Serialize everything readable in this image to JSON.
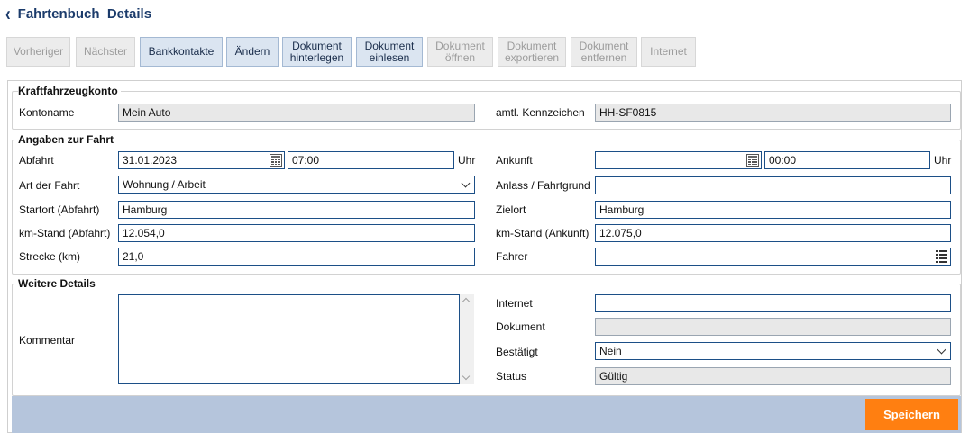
{
  "header": {
    "title": "Fahrtenbuch  Details"
  },
  "toolbar": {
    "vorheriger": "Vorheriger",
    "naechster": "Nächster",
    "bankkontakte": "Bankkontakte",
    "aendern": "Ändern",
    "dok_hinterlegen_1": "Dokument",
    "dok_hinterlegen_2": "hinterlegen",
    "dok_einlesen_1": "Dokument",
    "dok_einlesen_2": "einlesen",
    "dok_oeffnen_1": "Dokument",
    "dok_oeffnen_2": "öffnen",
    "dok_exportieren_1": "Dokument",
    "dok_exportieren_2": "exportieren",
    "dok_entfernen_1": "Dokument",
    "dok_entfernen_2": "entfernen",
    "internet": "Internet"
  },
  "konto": {
    "legend": "Kraftfahrzeugkonto",
    "kontoname_label": "Kontoname",
    "kontoname": "Mein Auto",
    "kennzeichen_label": "amtl. Kennzeichen",
    "kennzeichen": "HH-SF0815"
  },
  "fahrt": {
    "legend": "Angaben zur Fahrt",
    "abfahrt_label": "Abfahrt",
    "abfahrt_datum": "31.01.2023",
    "abfahrt_zeit": "07:00",
    "uhr": "Uhr",
    "ankunft_label": "Ankunft",
    "ankunft_datum": "",
    "ankunft_zeit": "00:00",
    "art_label": "Art der Fahrt",
    "art": "Wohnung / Arbeit",
    "anlass_label": "Anlass / Fahrtgrund",
    "anlass": "",
    "startort_label": "Startort (Abfahrt)",
    "startort": "Hamburg",
    "zielort_label": "Zielort",
    "zielort": "Hamburg",
    "km_abfahrt_label": "km-Stand (Abfahrt)",
    "km_abfahrt": "12.054,0",
    "km_ankunft_label": "km-Stand (Ankunft)",
    "km_ankunft": "12.075,0",
    "strecke_label": "Strecke (km)",
    "strecke": "21,0",
    "fahrer_label": "Fahrer",
    "fahrer": ""
  },
  "details": {
    "legend": "Weitere Details",
    "kommentar_label": "Kommentar",
    "kommentar": "",
    "internet_label": "Internet",
    "internet": "",
    "dokument_label": "Dokument",
    "dokument": "",
    "bestaetigt_label": "Bestätigt",
    "bestaetigt": "Nein",
    "status_label": "Status",
    "status": "Gültig"
  },
  "footer": {
    "save_label": "Speichern"
  }
}
